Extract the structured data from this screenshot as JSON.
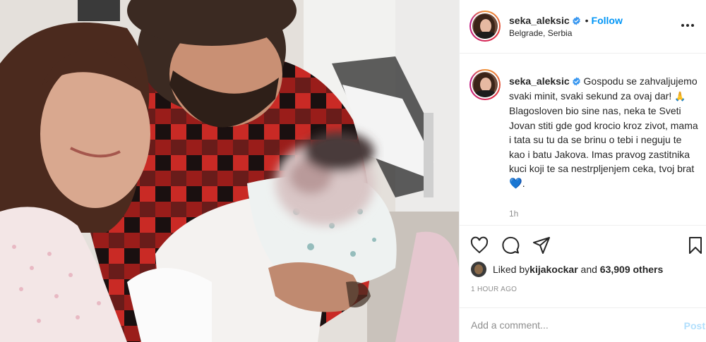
{
  "post": {
    "photo_icon": "photo-of-parents-with-newborn",
    "username": "seka_aleksic",
    "verified_icon": "verified-badge-icon",
    "follow_label": "Follow",
    "dot": "•",
    "location": "Belgrade, Serbia",
    "more_icon": "more-options-icon"
  },
  "caption": {
    "username": "seka_aleksic",
    "line1": " Gospodu se zahvaljujemo svaki minit, svaki sekund za ovaj dar! ",
    "emoji_hands": "🙏",
    "line2": " Blagosloven bio sine nas, neka te Sveti Jovan stiti gde god krocio kroz zivot, mama i tata su tu da se brinu o tebi i neguju te kao i batu Jakova. Imas pravog zastitnika kuci koji te sa nestrpljenjem ceka, tvoj brat ",
    "emoji_heart": "💙",
    "end": ".",
    "age": "1h"
  },
  "actions": {
    "like_icon": "heart-icon",
    "comment_icon": "comment-icon",
    "share_icon": "share-icon",
    "save_icon": "bookmark-icon"
  },
  "likes": {
    "prefix": "Liked by ",
    "user": "kijakockar",
    "middle": " and ",
    "others": "63,909 others"
  },
  "timestamp": "1 HOUR AGO",
  "comment_box": {
    "placeholder": "Add a comment...",
    "post_label": "Post"
  },
  "colors": {
    "accent": "#0095f6",
    "post_disabled": "#b2dffc",
    "muted": "#8e8e8e"
  }
}
